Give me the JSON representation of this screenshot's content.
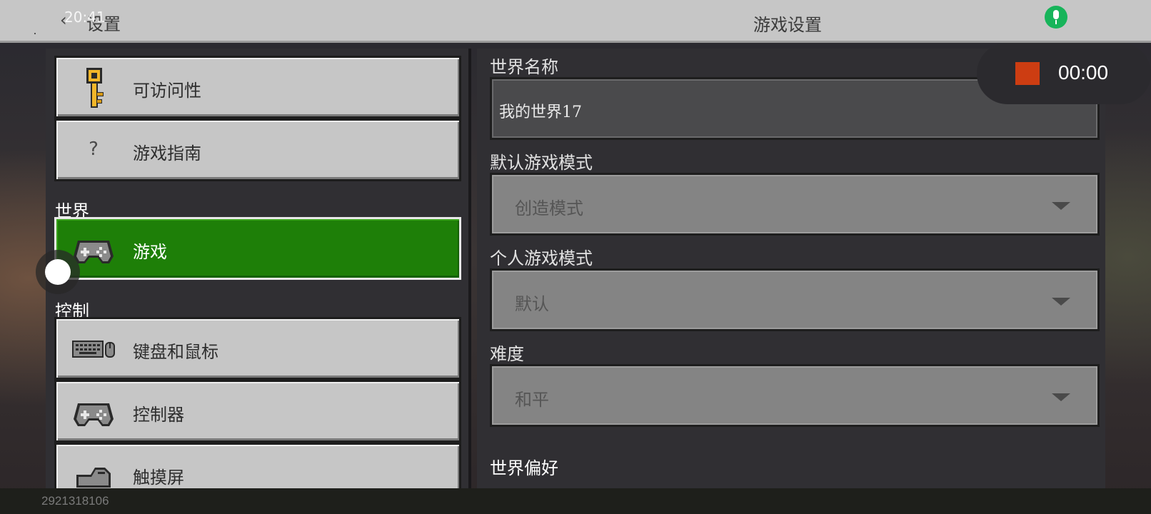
{
  "topbar": {
    "back_icon": "chevron-left-icon",
    "back_label": "设置",
    "clock": "20:41",
    "title": "游戏设置",
    "mic_icon": "microphone-icon"
  },
  "sidebar": {
    "items_top": [
      {
        "label": "可访问性",
        "icon": "key-icon"
      },
      {
        "label": "游戏指南",
        "icon": "question-mark-icon",
        "glyph": "?"
      }
    ],
    "section_world": "世界",
    "world_item": {
      "label": "游戏",
      "icon": "gamepad-icon",
      "selected": true
    },
    "section_controls": "控制",
    "controls_items": [
      {
        "label": "键盘和鼠标",
        "icon": "keyboard-mouse-icon"
      },
      {
        "label": "控制器",
        "icon": "gamepad-icon"
      },
      {
        "label": "触摸屏",
        "icon": "touch-hand-icon"
      }
    ]
  },
  "main": {
    "world_name_label": "世界名称",
    "world_name_value": "我的世界17",
    "default_mode_label": "默认游戏模式",
    "default_mode_value": "创造模式",
    "personal_mode_label": "个人游戏模式",
    "personal_mode_value": "默认",
    "difficulty_label": "难度",
    "difficulty_value": "和平",
    "preferences_title": "世界偏好"
  },
  "recorder": {
    "time": "00:00",
    "stop_icon": "stop-icon",
    "stop_color": "#cd3d12"
  },
  "watermark": "2921318106",
  "colors": {
    "selected_green": "#1e7f08",
    "button_gray": "#c6c6c6",
    "panel_dark": "#302f33"
  }
}
